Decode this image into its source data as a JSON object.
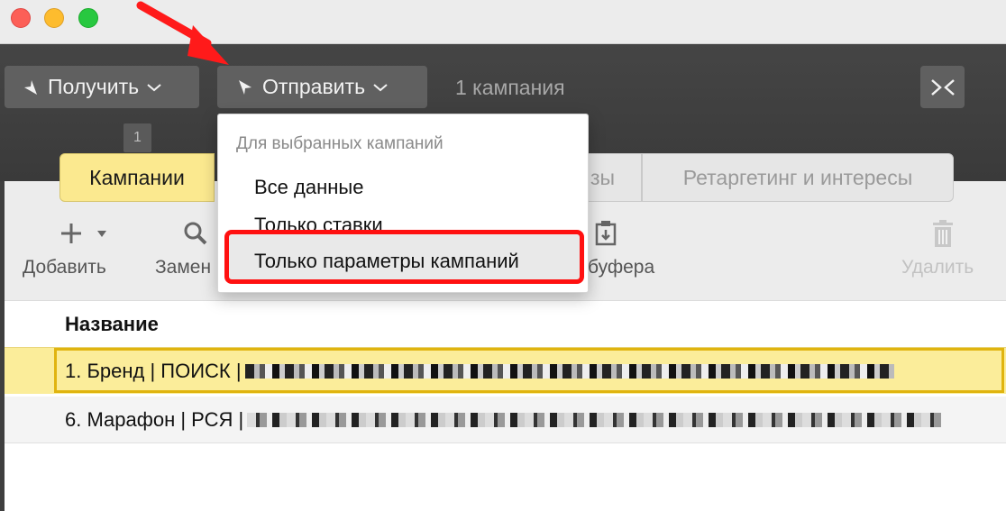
{
  "toolbar": {
    "receive_label": "Получить",
    "send_label": "Отправить",
    "campaign_count": "1 кампания",
    "badge": "1"
  },
  "tabs": {
    "campaigns": "Кампании",
    "phrases_fragment": "зы",
    "retargeting": "Ретаргетинг и интересы"
  },
  "actions": {
    "add": "Добавить",
    "replace": "Замен",
    "paste_from_buffer": "буфера",
    "delete": "Удалить"
  },
  "table": {
    "column_name": "Название",
    "rows": [
      {
        "label": "1. Бренд | ПОИСК |",
        "selected": true
      },
      {
        "label": "6. Марафон | РСЯ |",
        "selected": false
      }
    ]
  },
  "send_menu": {
    "header": "Для выбранных кампаний",
    "items": [
      "Все данные",
      "Только ставки",
      "Только параметры кампаний"
    ],
    "highlighted_index": 2
  },
  "colors": {
    "tab_active": "#fbe98f",
    "selected_row": "#fbed9a",
    "highlight_border": "#ff1010",
    "annotation_arrow": "#ff1a1a"
  }
}
